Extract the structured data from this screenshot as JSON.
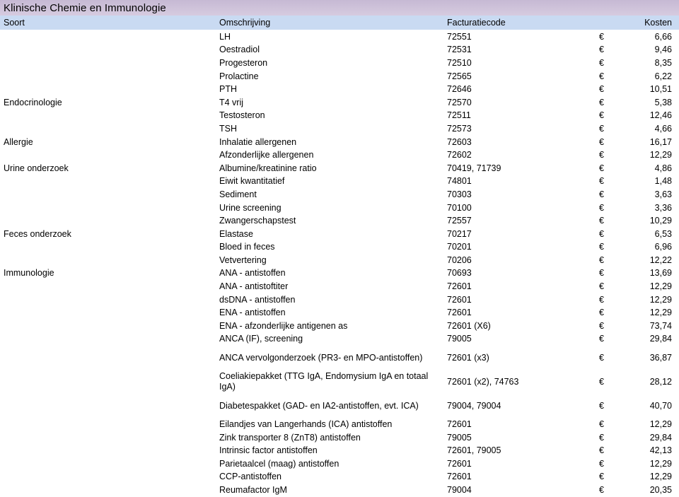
{
  "title": "Klinische Chemie en Immunologie",
  "columns": {
    "soort": "Soort",
    "omschrijving": "Omschrijving",
    "facturatiecode": "Facturatiecode",
    "kosten": "Kosten"
  },
  "currency_symbol": "€",
  "colors": {
    "title_band": "#cfc3da",
    "header_row": "#c9daf2",
    "text": "#000000",
    "page_background": "#ffffff"
  },
  "rows": [
    {
      "soort": "",
      "omschrijving": "LH",
      "code": "72551",
      "eur": "€",
      "kosten": "6,66",
      "tall": false
    },
    {
      "soort": "",
      "omschrijving": "Oestradiol",
      "code": "72531",
      "eur": "€",
      "kosten": "9,46",
      "tall": false
    },
    {
      "soort": "",
      "omschrijving": "Progesteron",
      "code": "72510",
      "eur": "€",
      "kosten": "8,35",
      "tall": false
    },
    {
      "soort": "",
      "omschrijving": "Prolactine",
      "code": "72565",
      "eur": "€",
      "kosten": "6,22",
      "tall": false
    },
    {
      "soort": "",
      "omschrijving": "PTH",
      "code": "72646",
      "eur": "€",
      "kosten": "10,51",
      "tall": false
    },
    {
      "soort": "Endocrinologie",
      "omschrijving": "T4 vrij",
      "code": "72570",
      "eur": "€",
      "kosten": "5,38",
      "tall": false
    },
    {
      "soort": "",
      "omschrijving": "Testosteron",
      "code": "72511",
      "eur": "€",
      "kosten": "12,46",
      "tall": false
    },
    {
      "soort": "",
      "omschrijving": "TSH",
      "code": "72573",
      "eur": "€",
      "kosten": "4,66",
      "tall": false
    },
    {
      "soort": "Allergie",
      "omschrijving": "Inhalatie allergenen",
      "code": "72603",
      "eur": "€",
      "kosten": "16,17",
      "tall": false
    },
    {
      "soort": "",
      "omschrijving": "Afzonderlijke allergenen",
      "code": "72602",
      "eur": "€",
      "kosten": "12,29",
      "tall": false
    },
    {
      "soort": "Urine onderzoek",
      "omschrijving": "Albumine/kreatinine ratio",
      "code": "70419, 71739",
      "eur": "€",
      "kosten": "4,86",
      "tall": false
    },
    {
      "soort": "",
      "omschrijving": "Eiwit kwantitatief",
      "code": "74801",
      "eur": "€",
      "kosten": "1,48",
      "tall": false
    },
    {
      "soort": "",
      "omschrijving": "Sediment",
      "code": "70303",
      "eur": "€",
      "kosten": "3,63",
      "tall": false
    },
    {
      "soort": "",
      "omschrijving": "Urine screening",
      "code": "70100",
      "eur": "€",
      "kosten": "3,36",
      "tall": false
    },
    {
      "soort": "",
      "omschrijving": "Zwangerschapstest",
      "code": "72557",
      "eur": "€",
      "kosten": "10,29",
      "tall": false
    },
    {
      "soort": "Feces onderzoek",
      "omschrijving": "Elastase",
      "code": "70217",
      "eur": "€",
      "kosten": "6,53",
      "tall": false
    },
    {
      "soort": "",
      "omschrijving": "Bloed in feces",
      "code": "70201",
      "eur": "€",
      "kosten": "6,96",
      "tall": false
    },
    {
      "soort": "",
      "omschrijving": "Vetvertering",
      "code": "70206",
      "eur": "€",
      "kosten": "12,22",
      "tall": false
    },
    {
      "soort": "Immunologie",
      "omschrijving": "ANA - antistoffen",
      "code": "70693",
      "eur": "€",
      "kosten": "13,69",
      "tall": false
    },
    {
      "soort": "",
      "omschrijving": "ANA - antistoftiter",
      "code": "72601",
      "eur": "€",
      "kosten": "12,29",
      "tall": false
    },
    {
      "soort": "",
      "omschrijving": "dsDNA - antistoffen",
      "code": "72601",
      "eur": "€",
      "kosten": "12,29",
      "tall": false
    },
    {
      "soort": "",
      "omschrijving": "ENA - antistoffen",
      "code": "72601",
      "eur": "€",
      "kosten": "12,29",
      "tall": false
    },
    {
      "soort": "",
      "omschrijving": "ENA - afzonderlijke antigenen as",
      "code": "72601 (X6)",
      "eur": "€",
      "kosten": "73,74",
      "tall": false
    },
    {
      "soort": "",
      "omschrijving": "ANCA (IF), screening",
      "code": "79005",
      "eur": "€",
      "kosten": "29,84",
      "tall": false
    },
    {
      "soort": "",
      "omschrijving": "ANCA vervolgonderzoek (PR3- en MPO-antistoffen)",
      "code": "72601 (x3)",
      "eur": "€",
      "kosten": "36,87",
      "tall": true
    },
    {
      "soort": "",
      "omschrijving": "Coeliakiepakket (TTG IgA, Endomysium IgA en totaal IgA)",
      "code": "72601 (x2), 74763",
      "eur": "€",
      "kosten": "28,12",
      "tall": true
    },
    {
      "soort": "",
      "omschrijving": "Diabetespakket (GAD- en IA2-antistoffen, evt. ICA)",
      "code": "79004, 79004",
      "eur": "€",
      "kosten": "40,70",
      "tall": true
    },
    {
      "soort": "",
      "omschrijving": "Eilandjes van Langerhands (ICA) antistoffen",
      "code": "72601",
      "eur": "€",
      "kosten": "12,29",
      "tall": false
    },
    {
      "soort": "",
      "omschrijving": "Zink transporter 8 (ZnT8) antistoffen",
      "code": "79005",
      "eur": "€",
      "kosten": "29,84",
      "tall": false
    },
    {
      "soort": "",
      "omschrijving": "Intrinsic factor antistoffen",
      "code": "72601, 79005",
      "eur": "€",
      "kosten": "42,13",
      "tall": false
    },
    {
      "soort": "",
      "omschrijving": "Parietaalcel (maag) antistoffen",
      "code": "72601",
      "eur": "€",
      "kosten": "12,29",
      "tall": false
    },
    {
      "soort": "",
      "omschrijving": "CCP-antistoffen",
      "code": "72601",
      "eur": "€",
      "kosten": "12,29",
      "tall": false
    },
    {
      "soort": "",
      "omschrijving": "Reumafactor IgM",
      "code": "79004",
      "eur": "€",
      "kosten": "20,35",
      "tall": false
    }
  ]
}
